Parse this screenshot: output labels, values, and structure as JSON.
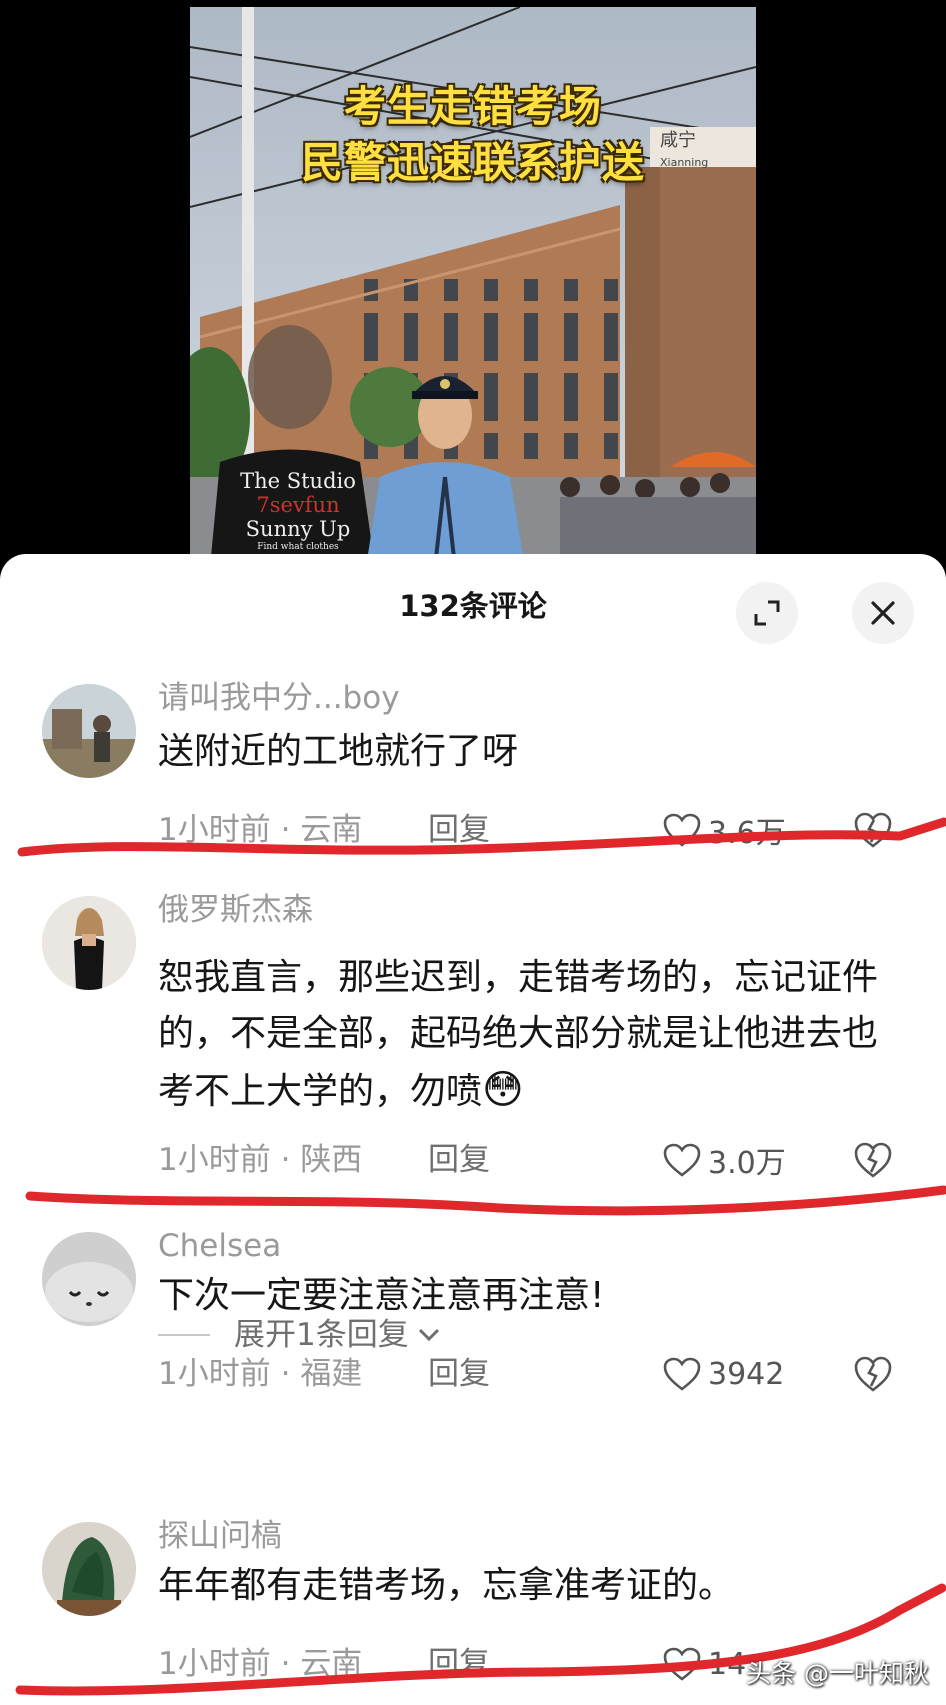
{
  "video": {
    "caption_line1": "考生走错考场",
    "caption_line2": "民警迅速联系护送",
    "shirt_line1": "The Studio",
    "shirt_line2": "7sevfun",
    "shirt_line3": "Sunny Up",
    "shirt_line4": "Find what clothes",
    "building_sign": "咸宁",
    "building_sign_pinyin": "Xianning",
    "colors": {
      "caption": "#ffe040",
      "building": "#b07a55",
      "sky": "#c3ccd6"
    }
  },
  "sheet": {
    "title": "132条评论",
    "expand_icon": "expand-icon",
    "close_icon": "close-icon"
  },
  "comments": [
    {
      "username": "请叫我中分...boy",
      "text": "送附近的工地就行了呀",
      "time": "1小时前",
      "location": "云南",
      "reply_label": "回复",
      "likes": "3.6万"
    },
    {
      "username": "俄罗斯杰森",
      "text": "恕我直言，那些迟到，走错考场的，忘记证件的，不是全部，起码绝大部分就是让他进去也考不上大学的，勿喷",
      "emoji": "😳",
      "time": "1小时前",
      "location": "陕西",
      "reply_label": "回复",
      "likes": "3.0万"
    },
    {
      "username": "Chelsea",
      "text": "下次一定要注意注意再注意!",
      "time": "1小时前",
      "location": "福建",
      "reply_label": "回复",
      "likes": "3942",
      "expand_replies": "展开1条回复"
    },
    {
      "username": "探山问槁",
      "text": "年年都有走错考场，忘拿准考证的。",
      "time": "1小时前",
      "location": "云南",
      "reply_label": "回复",
      "likes": "14"
    }
  ],
  "meta_separator": "·",
  "watermark": "头条 @一叶知秋",
  "annotation_color": "#e0282c"
}
